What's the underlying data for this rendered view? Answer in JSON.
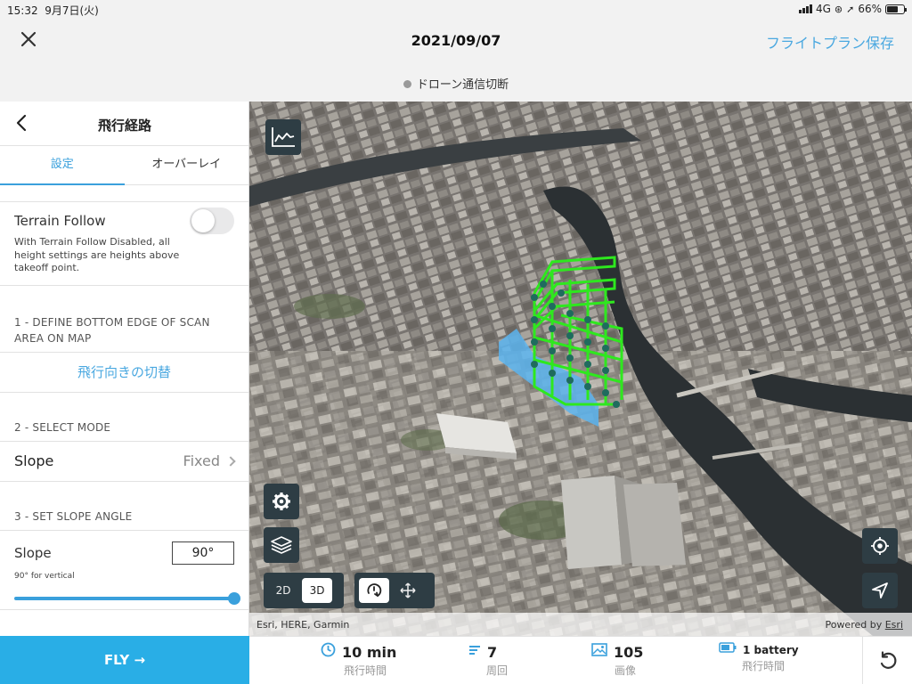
{
  "status_bar": {
    "time": "15:32",
    "date": "9月7日(火)",
    "network": "4G",
    "battery": "66%",
    "battery_level": 0.66
  },
  "header": {
    "title": "2021/09/07",
    "save_label": "フライトプラン保存",
    "connection_status": "ドローン通信切断"
  },
  "panel": {
    "title": "飛行経路",
    "tabs": [
      {
        "label": "設定",
        "active": true
      },
      {
        "label": "オーバーレイ",
        "active": false
      }
    ],
    "terrain_follow": {
      "title": "Terrain Follow",
      "enabled": false,
      "description": "With Terrain Follow Disabled, all height settings are heights above takeoff point."
    },
    "section1": {
      "heading": "1 - DEFINE BOTTOM EDGE OF SCAN AREA ON MAP",
      "action_label": "飛行向きの切替"
    },
    "section2": {
      "heading": "2 - SELECT MODE",
      "option_label": "Slope",
      "option_value": "Fixed"
    },
    "section3": {
      "heading": "3 - SET SLOPE ANGLE",
      "label": "Slope",
      "value": "90°",
      "hint": "90° for vertical",
      "slider_level": 1.0
    }
  },
  "fly_button": {
    "label": "FLY →"
  },
  "map": {
    "view_modes": [
      {
        "label": "2D",
        "active": false
      },
      {
        "label": "3D",
        "active": true
      }
    ],
    "attribution_left": "Esri, HERE, Garmin",
    "attribution_right_prefix": "Powered by ",
    "attribution_right_link": "Esri",
    "colors": {
      "flight_path": "#2ee81e",
      "scan_area": "#5ab4ef",
      "waypoint": "#1f6b5e",
      "button_bg": "#2e3d44"
    }
  },
  "stats": [
    {
      "value": "10 min",
      "label": "飛行時間",
      "icon": "clock-icon"
    },
    {
      "value": "7",
      "label": "周回",
      "icon": "laps-icon"
    },
    {
      "value": "105",
      "label": "画像",
      "icon": "image-icon"
    },
    {
      "value": "1 battery",
      "label": "飛行時間",
      "icon": "battery-icon"
    }
  ]
}
